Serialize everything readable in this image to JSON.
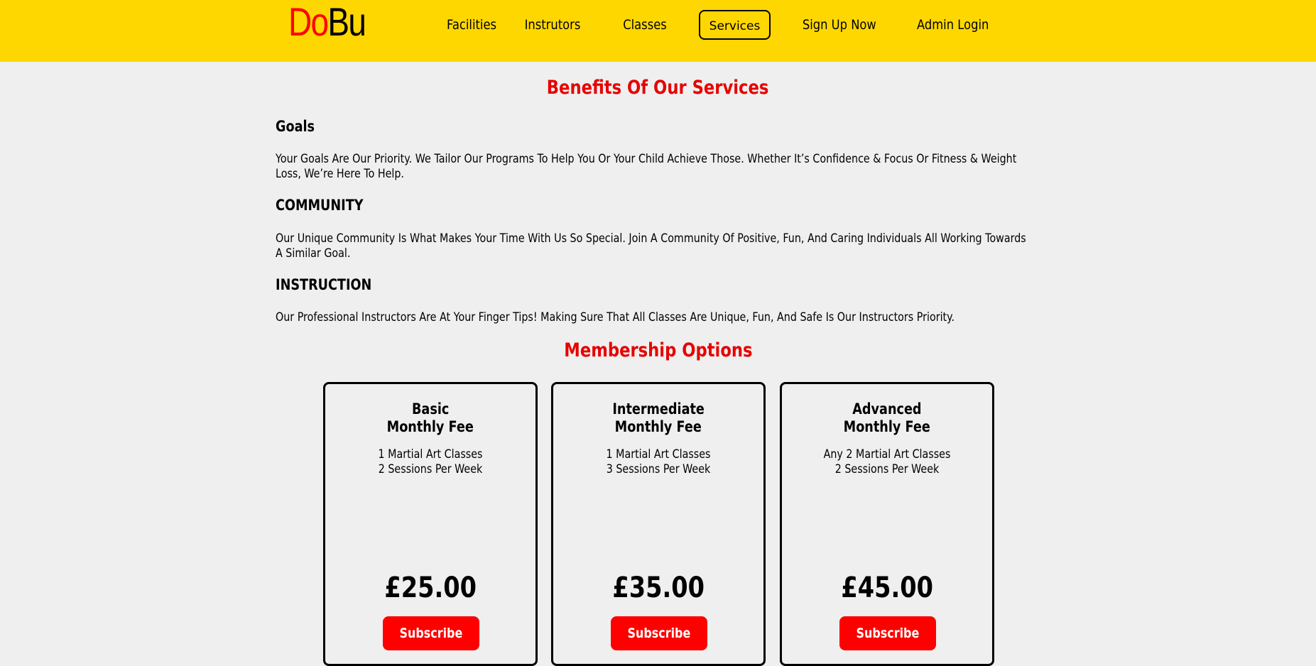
{
  "brand": {
    "logo_part1": "Do",
    "logo_part2": "Bu",
    "accent_color": "#ff0000",
    "header_color": "#ffd700"
  },
  "nav": {
    "items": [
      {
        "label": "Facilities",
        "active": false
      },
      {
        "label": "Instrutors",
        "active": false
      },
      {
        "label": "Classes",
        "active": false
      },
      {
        "label": "Services",
        "active": true
      },
      {
        "label": "Sign Up Now",
        "active": false
      },
      {
        "label": "Admin Login",
        "active": false
      }
    ]
  },
  "benefits": {
    "heading": "Benefits Of Our Services",
    "sections": [
      {
        "title": "Goals",
        "text": "Your Goals Are Our Priority. We Tailor Our Programs To Help You Or Your Child Achieve Those. Whether It’s Confidence & Focus Or Fitness & Weight Loss, We’re Here To Help."
      },
      {
        "title": "COMMUNITY",
        "text": "Our Unique Community Is What Makes Your Time With Us So Special. Join A Community Of Positive, Fun, And Caring Individuals All Working Towards A Similar Goal."
      },
      {
        "title": "INSTRUCTION",
        "text": "Our Professional Instructors Are At Your Finger Tips! Making Sure That All Classes Are Unique, Fun, And Safe Is Our Instructors Priority."
      }
    ]
  },
  "membership": {
    "heading": "Membership Options",
    "plans": [
      {
        "title_line1": "Basic",
        "title_line2": "Monthly Fee",
        "desc_line1": "1 Martial Art Classes",
        "desc_line2": "2 Sessions Per Week",
        "price": "£25.00",
        "button": "Subscribe"
      },
      {
        "title_line1": "Intermediate",
        "title_line2": "Monthly Fee",
        "desc_line1": "1 Martial Art Classes",
        "desc_line2": "3 Sessions Per Week",
        "price": "£35.00",
        "button": "Subscribe"
      },
      {
        "title_line1": "Advanced",
        "title_line2": "Monthly Fee",
        "desc_line1": "Any 2 Martial Art Classes",
        "desc_line2": "2 Sessions Per Week",
        "price": "£45.00",
        "button": "Subscribe"
      }
    ]
  }
}
